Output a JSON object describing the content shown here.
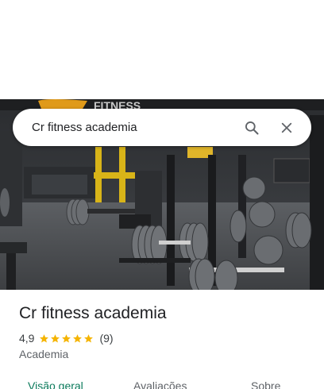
{
  "search": {
    "query": "Cr fitness academia"
  },
  "icons": {
    "search": "search-icon",
    "close": "close-icon",
    "star": "star-icon"
  },
  "photo": {
    "sign_text": "FITNESS"
  },
  "place": {
    "name": "Cr fitness academia",
    "rating": "4,9",
    "stars": 5,
    "reviews": "(9)",
    "category": "Academia"
  },
  "tabs": [
    {
      "label": "Visão geral"
    },
    {
      "label": "Avaliações"
    },
    {
      "label": "Sobre"
    }
  ],
  "colors": {
    "star": "#f5b400",
    "active_tab": "#0b7a5b",
    "text": "#202124"
  }
}
